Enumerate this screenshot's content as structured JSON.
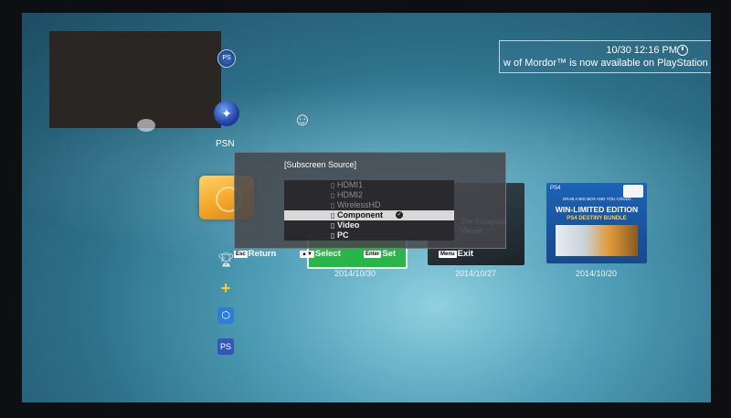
{
  "clock": {
    "time": "10/30 12:16 PM",
    "notification": "w of Mordor™ is now available on PlayStation"
  },
  "xmb": {
    "psn_label": "PSN",
    "top_icon_text": "PS",
    "icons": [
      "trophy-icon",
      "playstation-plus-icon",
      "playstation-store-icon",
      "ps-button-icon"
    ]
  },
  "tiles": {
    "dark_tile_text": "The Escapists Viewer",
    "ps4_logo": "PS4",
    "ps4_small_text": "GRAB A BIG BOX AND YOU COULD",
    "ps4_title": "WIN-LIMITED EDITION",
    "ps4_subtitle": "PS4 DESTINY BUNDLE",
    "dates": [
      "2014/10/30",
      "2014/10/27",
      "2014/10/20"
    ]
  },
  "osd": {
    "title": "[Subscreen Source]",
    "items": [
      {
        "label": "HDMI1"
      },
      {
        "label": "HDMI2"
      },
      {
        "label": "WirelessHD"
      },
      {
        "label": "Component"
      },
      {
        "label": "Video"
      },
      {
        "label": "PC"
      }
    ],
    "footer": {
      "return_key": "Esc",
      "return_label": "Return",
      "select_key": "▲▼",
      "select_label": "Select",
      "enter_key": "Enter",
      "set_label": "Set",
      "menu_key": "Menu",
      "exit_label": "Exit"
    }
  },
  "colors": {
    "background": "#2d7088",
    "selected_row": "#d9d9d9",
    "osd_panel": "#46464c",
    "tile_gold": "#f2a628",
    "tile_green": "#2ab54a"
  }
}
